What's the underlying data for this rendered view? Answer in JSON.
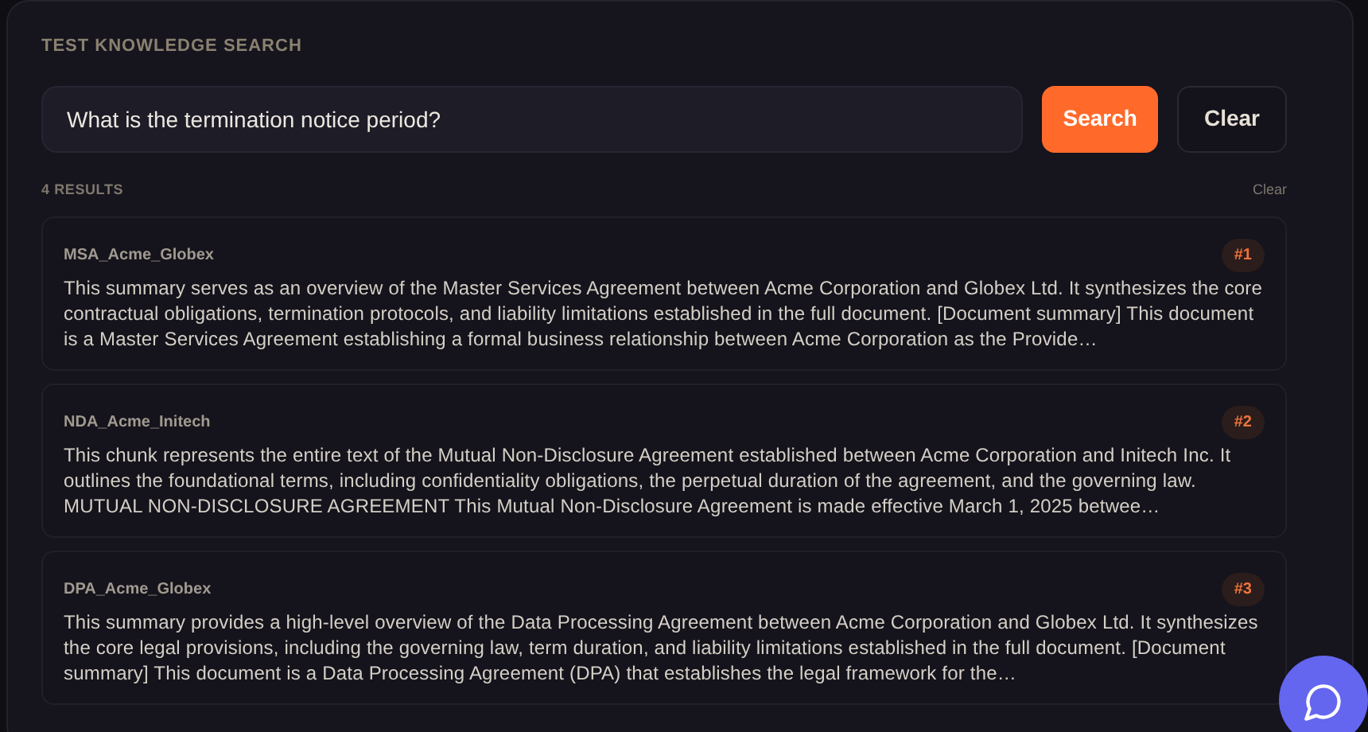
{
  "title": "TEST KNOWLEDGE SEARCH",
  "search": {
    "value": "What is the termination notice period?"
  },
  "buttons": {
    "search": "Search",
    "clear": "Clear"
  },
  "results_header": {
    "count": "4 RESULTS",
    "clear": "Clear"
  },
  "results": [
    {
      "source": "MSA_Acme_Globex",
      "rank": "#1",
      "text": "This summary serves as an overview of the Master Services Agreement between Acme Corporation and Globex Ltd. It synthesizes the core contractual obligations, termination protocols, and liability limitations established in the full document. [Document summary] This document is a Master Services Agreement establishing a formal business relationship between Acme Corporation as the Provide…"
    },
    {
      "source": "NDA_Acme_Initech",
      "rank": "#2",
      "text": "This chunk represents the entire text of the Mutual Non-Disclosure Agreement established between Acme Corporation and Initech Inc. It outlines the foundational terms, including confidentiality obligations, the perpetual duration of the agreement, and the governing law. MUTUAL NON-DISCLOSURE AGREEMENT This Mutual Non-Disclosure Agreement is made effective March 1, 2025 betwee…"
    },
    {
      "source": "DPA_Acme_Globex",
      "rank": "#3",
      "text": "This summary provides a high-level overview of the Data Processing Agreement between Acme Corporation and Globex Ltd. It synthesizes the core legal provisions, including the governing law, term duration, and liability limitations established in the full document. [Document summary] This document is a Data Processing Agreement (DPA) that establishes the legal framework for the…"
    }
  ]
}
